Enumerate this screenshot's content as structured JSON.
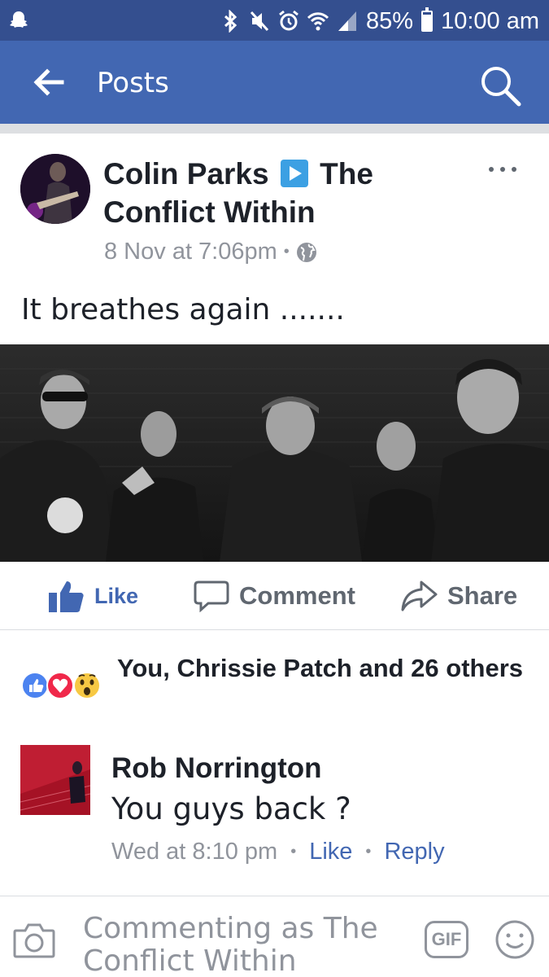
{
  "status_bar": {
    "battery_percent": "85%",
    "battery_level": 0.85,
    "time": "10:00 am",
    "icons": [
      "snapchat-ghost-icon",
      "bluetooth-icon",
      "mute-icon",
      "alarm-icon",
      "wifi-icon",
      "signal-icon",
      "battery-icon"
    ]
  },
  "header": {
    "title": "Posts",
    "back_icon": "arrow-left-icon",
    "search_icon": "search-icon",
    "color": "#4267b2"
  },
  "post": {
    "author": "Colin Parks",
    "page": "The Conflict Within",
    "timestamp": "8 Nov at 7:06pm",
    "separator": "•",
    "privacy_icon": "globe-icon",
    "text": "It breathes again .......",
    "more_icon": "more-horizontal-icon"
  },
  "actions": {
    "like": "Like",
    "comment": "Comment",
    "share": "Share"
  },
  "reactions": {
    "text": "You, Chrissie Patch and 26 others",
    "icons": [
      "like-reaction-icon",
      "love-reaction-icon",
      "wow-reaction-icon"
    ]
  },
  "comment": {
    "author": "Rob Norrington",
    "text": "You guys back ?",
    "time": "Wed at 8:10 pm",
    "dot": "•",
    "like": "Like",
    "reply": "Reply"
  },
  "composer": {
    "placeholder": "Commenting as The Conflict Within",
    "gif": "GIF"
  },
  "colors": {
    "status_bar": "#344f8f",
    "link": "#4267b2",
    "muted": "#90949c"
  }
}
